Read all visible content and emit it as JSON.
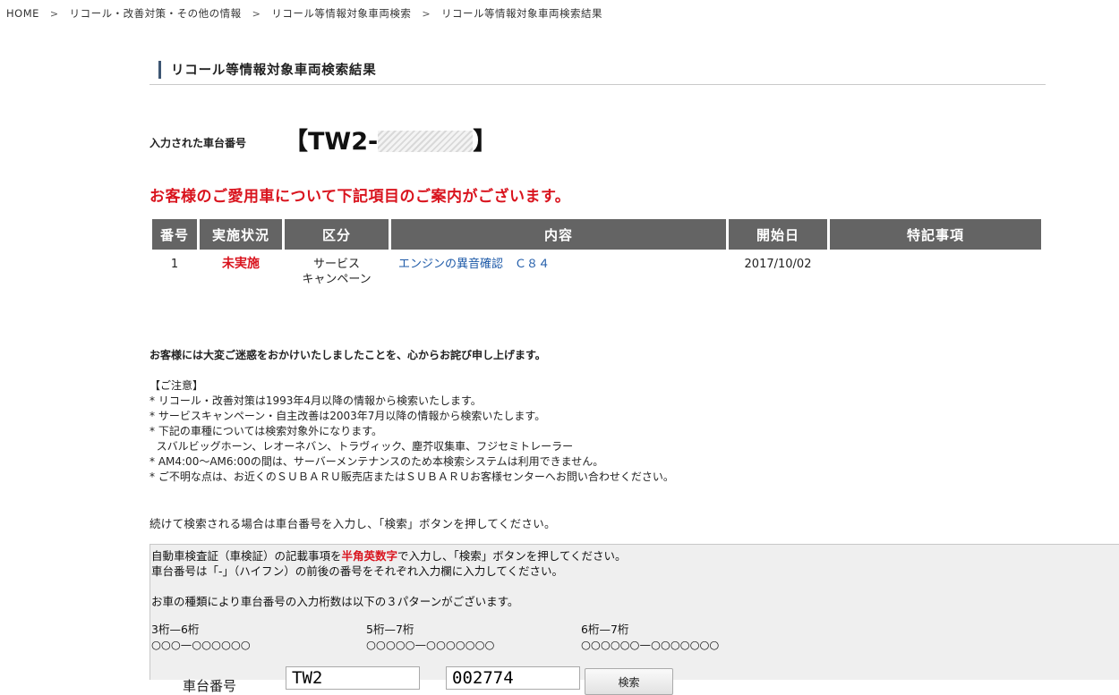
{
  "breadcrumb": {
    "items": [
      "HOME",
      "リコール・改善対策・その他の情報",
      "リコール等情報対象車両検索",
      "リコール等情報対象車両検索結果"
    ],
    "separator": ">"
  },
  "page_title": "リコール等情報対象車両検索結果",
  "chassis": {
    "label": "入力された車台番号",
    "open": "【",
    "prefix": "TW2-",
    "close": "】"
  },
  "notice": "お客様のご愛用車について下記項目のご案内がございます。",
  "table": {
    "headers": [
      "番号",
      "実施状況",
      "区分",
      "内容",
      "開始日",
      "特記事項"
    ],
    "rows": [
      {
        "number": "1",
        "status": "未実施",
        "category_line1": "サービス",
        "category_line2": "キャンペーン",
        "content": "エンジンの異音確認　Ｃ８４",
        "start_date": "2017/10/02",
        "remarks": ""
      }
    ]
  },
  "apology": "お客様には大変ご迷惑をおかけいたしましたことを、心からお詫び申し上げます。",
  "notes": {
    "heading": "【ご注意】",
    "lines": [
      "* リコール・改善対策は1993年4月以降の情報から検索いたします。",
      "* サービスキャンペーン・自主改善は2003年7月以降の情報から検索いたします。",
      "* 下記の車種については検索対象外になります。",
      "  スバルビッグホーン、レオーネバン、トラヴィック、塵芥収集車、フジセミトレーラー",
      "* AM4:00～AM6:00の間は、サーバーメンテナンスのため本検索システムは利用できません。",
      "* ご不明な点は、お近くのＳＵＢＡＲＵ販売店またはＳＵＢＡＲＵお客様センターへお問い合わせください。"
    ]
  },
  "continue_text": "続けて検索される場合は車台番号を入力し、「検索」ボタンを押してください。",
  "form": {
    "instruction_pre": "自動車検査証（車検証）の記載事項を",
    "instruction_highlight": "半角英数字",
    "instruction_post": "で入力し、「検索」ボタンを押してください。",
    "instruction2": "車台番号は「-」（ハイフン）の前後の番号をそれぞれ入力欄に入力してください。",
    "instruction3": "お車の種類により車台番号の入力桁数は以下の３パターンがございます。",
    "patterns": [
      {
        "label": "3桁—6桁",
        "example": "○○○—○○○○○○"
      },
      {
        "label": "5桁—7桁",
        "example": "○○○○○—○○○○○○○"
      },
      {
        "label": "6桁—7桁",
        "example": "○○○○○○—○○○○○○○"
      }
    ],
    "field_label": "車台番号",
    "prefix_value": "TW2",
    "number_value": "002774",
    "search_button": "検索"
  }
}
